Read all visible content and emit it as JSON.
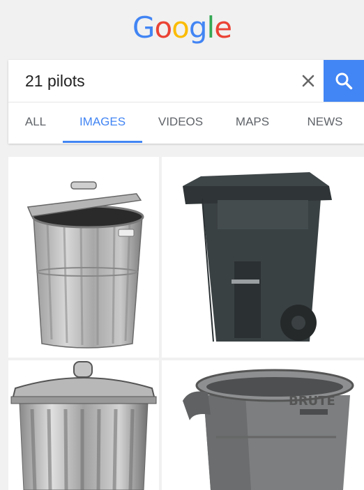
{
  "logo": {
    "letters": [
      "G",
      "o",
      "o",
      "g",
      "l",
      "e"
    ],
    "colors": [
      "#4285f4",
      "#ea4335",
      "#fbbc05",
      "#4285f4",
      "#34a853",
      "#ea4335"
    ]
  },
  "search": {
    "query": "21 pilots",
    "clear_icon": "close-icon",
    "search_icon": "search-icon",
    "accent_color": "#4285f4"
  },
  "tabs": [
    {
      "label": "ALL",
      "active": false
    },
    {
      "label": "IMAGES",
      "active": true
    },
    {
      "label": "VIDEOS",
      "active": false
    },
    {
      "label": "MAPS",
      "active": false
    },
    {
      "label": "NEWS",
      "active": false
    }
  ],
  "results": {
    "images": [
      {
        "subject": "galvanized metal trash can with lid ajar"
      },
      {
        "subject": "dark grey wheeled trash cart"
      },
      {
        "subject": "galvanized metal trash can with lid"
      },
      {
        "subject": "grey Brute trash can",
        "label": "BRUTE"
      }
    ]
  }
}
